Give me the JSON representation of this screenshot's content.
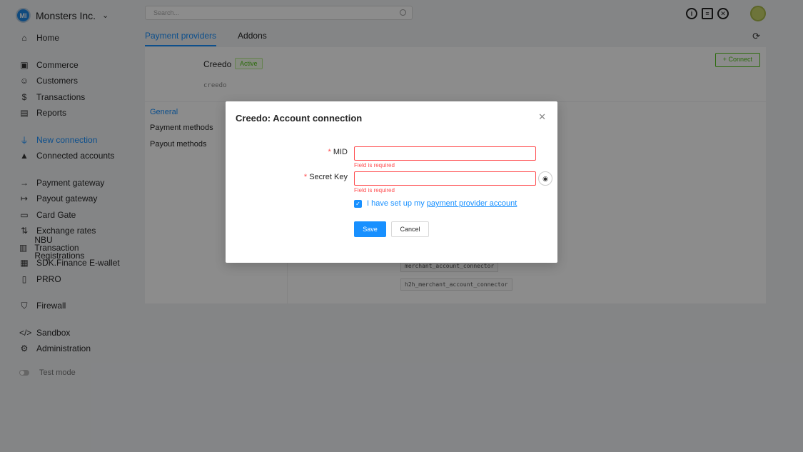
{
  "brand": {
    "logo": "MI",
    "name": "Monsters Inc."
  },
  "sidebar": {
    "items": [
      {
        "label": "Home",
        "icon": "home-icon"
      },
      {
        "label": "Commerce",
        "icon": "store-icon"
      },
      {
        "label": "Customers",
        "icon": "users-icon"
      },
      {
        "label": "Transactions",
        "icon": "dollar-icon"
      },
      {
        "label": "Reports",
        "icon": "file-icon"
      },
      {
        "label": "New connection",
        "icon": "plug-icon"
      },
      {
        "label": "Connected accounts",
        "icon": "lock-icon"
      },
      {
        "label": "Payment gateway",
        "icon": "login-icon"
      },
      {
        "label": "Payout gateway",
        "icon": "logout-icon"
      },
      {
        "label": "Card Gate",
        "icon": "card-icon"
      },
      {
        "label": "Exchange rates",
        "icon": "exchange-icon"
      },
      {
        "label": "NBU Transaction Registrations",
        "icon": "doc-icon"
      },
      {
        "label": "SDK.Finance E-wallet",
        "icon": "wallet-icon"
      },
      {
        "label": "PRRO",
        "icon": "receipt-icon"
      },
      {
        "label": "Firewall",
        "icon": "shield-icon"
      },
      {
        "label": "Sandbox",
        "icon": "code-icon"
      },
      {
        "label": "Administration",
        "icon": "gear-icon"
      }
    ],
    "test_mode": "Test mode"
  },
  "search": {
    "placeholder": "Search..."
  },
  "tabs": [
    "Payment providers",
    "Addons"
  ],
  "provider": {
    "name": "Creedo",
    "status": "Active",
    "code": "creedo",
    "connect_label": "+ Connect"
  },
  "submenu": [
    "General",
    "Payment methods",
    "Payout methods"
  ],
  "connectors": [
    "merchant_account_connector",
    "h2h_merchant_account_connector"
  ],
  "modal": {
    "title": "Creedo: Account connection",
    "mid_label": "MID",
    "secret_label": "Secret Key",
    "error": "Field is required",
    "check_text": "I have set up my ",
    "check_link": "payment provider account",
    "save": "Save",
    "cancel": "Cancel"
  }
}
